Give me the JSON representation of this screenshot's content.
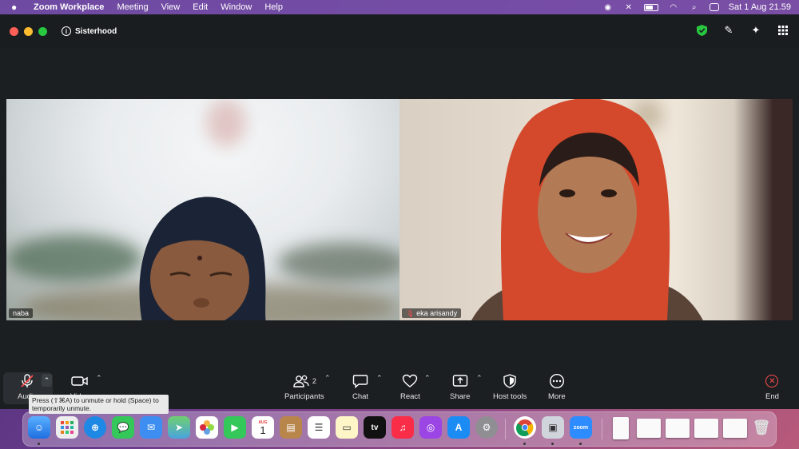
{
  "menubar": {
    "app_name": "Zoom Workplace",
    "menus": [
      "Meeting",
      "View",
      "Edit",
      "Window",
      "Help"
    ],
    "clock": "Sat 1 Aug  21.59"
  },
  "window": {
    "meeting_title": "Sisterhood"
  },
  "participants": [
    {
      "name": "naba"
    },
    {
      "name": "eka arisandy"
    }
  ],
  "toolbar": {
    "audio_label": "Audio",
    "video_label": "Video",
    "participants_label": "Participants",
    "participants_count": "2",
    "chat_label": "Chat",
    "react_label": "React",
    "share_label": "Share",
    "host_tools_label": "Host tools",
    "more_label": "More",
    "end_label": "End"
  },
  "tooltip": {
    "text": "Press (⇧⌘A) to unmute or hold (Space) to temporarily unmute."
  },
  "dock": {
    "calendar_month": "AUG",
    "calendar_day": "1",
    "tv_label": "tv",
    "zoom_label": "zoom"
  },
  "colors": {
    "zoom_bg": "#1c1f22",
    "end_red": "#ff4d4f",
    "shield_green": "#28c840"
  }
}
